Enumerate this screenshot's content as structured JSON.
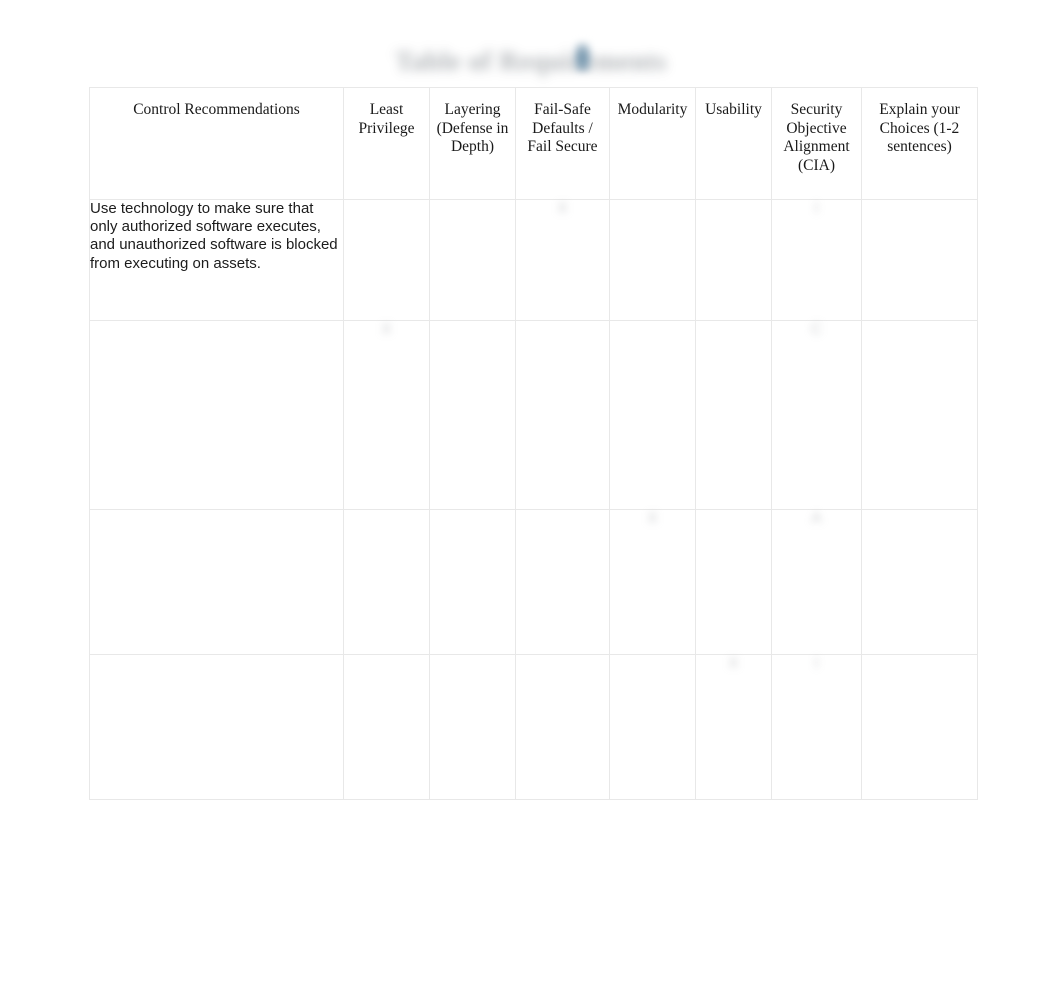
{
  "document": {
    "title": "Table of Requirements",
    "title_legible": false,
    "cursor_icon": "text-cursor-icon"
  },
  "colors": {
    "header_shaded_bg": "#c8c8c8",
    "header_plain_bg": "#ffffff",
    "border": "#e8e8e8",
    "text": "#1a1a1a",
    "cursor_accent": "#6f93ab"
  },
  "table": {
    "columns": [
      {
        "key": "control",
        "label": "Control Recommendations",
        "shaded": false
      },
      {
        "key": "least",
        "label": "Least Privilege",
        "shaded": true
      },
      {
        "key": "layering",
        "label": "Layering (Defense in Depth)",
        "shaded": true
      },
      {
        "key": "failsafe",
        "label": "Fail-Safe Defaults / Fail Secure",
        "shaded": true
      },
      {
        "key": "modular",
        "label": "Modularity",
        "shaded": true
      },
      {
        "key": "usability",
        "label": "Usability",
        "shaded": true
      },
      {
        "key": "security",
        "label": "Security Objective Alignment (CIA)",
        "shaded": false
      },
      {
        "key": "explain",
        "label": "Explain your Choices (1-2 sentences)",
        "shaded": false
      }
    ],
    "rows": [
      {
        "control": "Use technology to make sure that only authorized software executes, and unauthorized software is blocked from executing on assets.",
        "control_legible": true,
        "least": "",
        "layering": "",
        "failsafe": "X",
        "modular": "",
        "usability": "",
        "security": "I",
        "explain": "",
        "explain_legible": false
      },
      {
        "control": "",
        "control_legible": false,
        "least": "X",
        "layering": "",
        "failsafe": "",
        "modular": "",
        "usability": "",
        "security": "C",
        "explain": "",
        "explain_legible": false
      },
      {
        "control": "",
        "control_legible": false,
        "least": "",
        "layering": "",
        "failsafe": "",
        "modular": "X",
        "usability": "",
        "security": "A",
        "explain": "",
        "explain_legible": false
      },
      {
        "control": "",
        "control_legible": false,
        "least": "",
        "layering": "",
        "failsafe": "",
        "modular": "",
        "usability": "X",
        "security": "I",
        "explain": "",
        "explain_legible": false
      }
    ]
  }
}
